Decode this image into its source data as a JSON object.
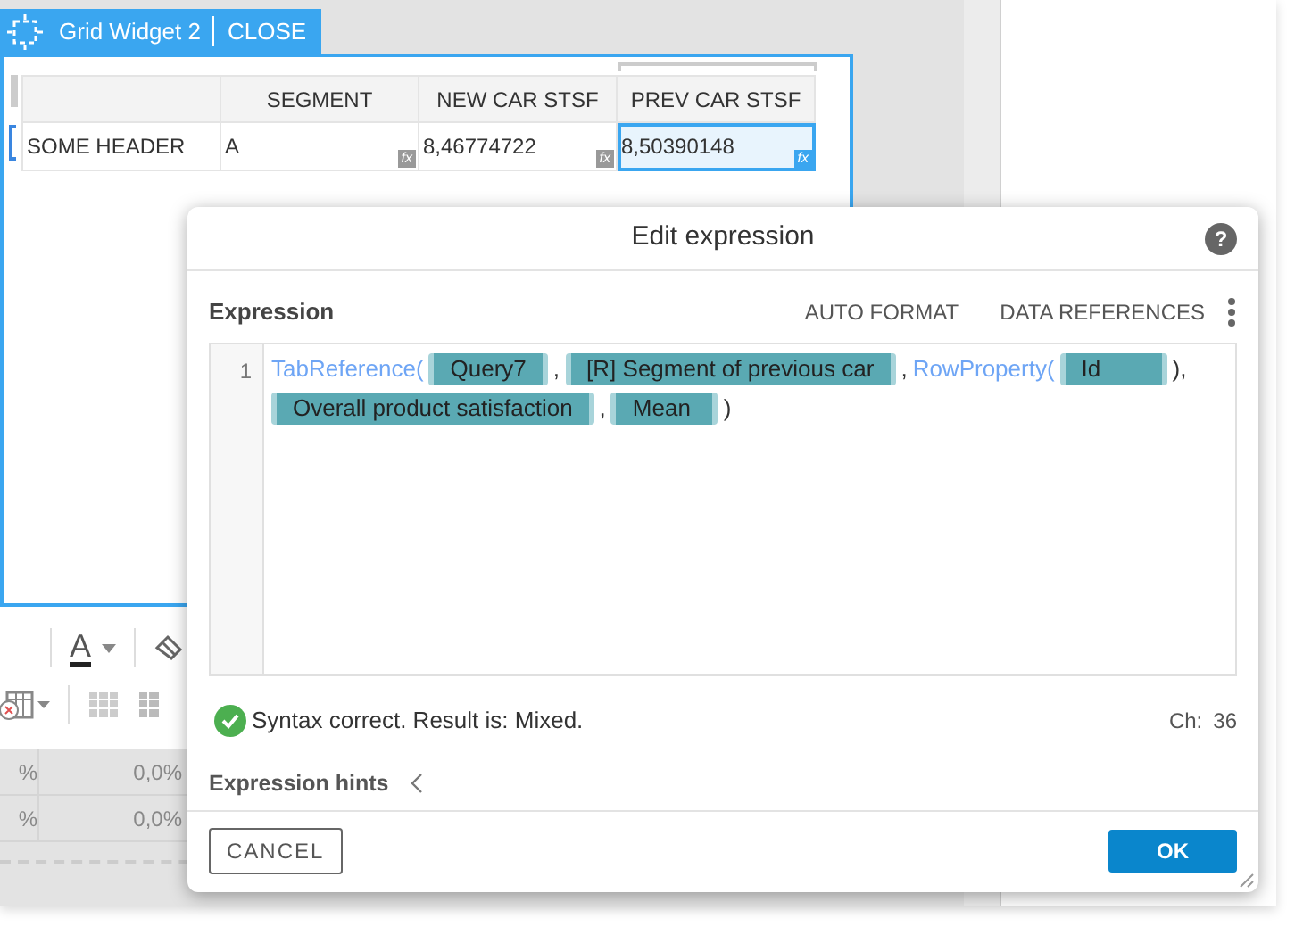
{
  "widget": {
    "title": "Grid Widget 2",
    "close": "CLOSE",
    "table": {
      "columns": [
        "SEGMENT",
        "NEW CAR STSF",
        "PREV CAR STSF"
      ],
      "rows": [
        {
          "header": "SOME HEADER",
          "cells": [
            {
              "text": "A",
              "marker": "fx",
              "selected": false
            },
            {
              "text": "8,46774722",
              "marker": "fx",
              "selected": false
            },
            {
              "text": "8,50390148",
              "marker": "fx",
              "selected": true
            }
          ]
        }
      ]
    }
  },
  "toolbar": {
    "font_color_glyph": "A"
  },
  "background_rows": [
    {
      "column_1": "%",
      "column_2": "0,0%"
    },
    {
      "column_1": "%",
      "column_2": "0,0%"
    }
  ],
  "dialog": {
    "title": "Edit expression",
    "help": "?",
    "label": "Expression",
    "actions": [
      "AUTO FORMAT",
      "DATA REFERENCES"
    ],
    "line_number": "1",
    "tokens": [
      {
        "kind": "func",
        "text": "TabReference("
      },
      {
        "kind": "chip",
        "text": "Query7"
      },
      {
        "kind": "plain",
        "text": ","
      },
      {
        "kind": "chip",
        "text": "[R] Segment of previous car"
      },
      {
        "kind": "plain",
        "text": ","
      },
      {
        "kind": "func",
        "text": "RowProperty("
      },
      {
        "kind": "chip",
        "text": "Id"
      },
      {
        "kind": "plain",
        "text": "),"
      },
      {
        "kind": "chip",
        "text": "Overall product satisfaction"
      },
      {
        "kind": "plain",
        "text": ","
      },
      {
        "kind": "chip",
        "text": "Mean"
      },
      {
        "kind": "plain",
        "text": ")"
      }
    ],
    "status": "Syntax correct. Result is: Mixed.",
    "valid": true,
    "char_label": "Ch:",
    "char_count": "36",
    "hints": "Expression hints",
    "hints_expanded": false,
    "cancel": "CANCEL",
    "ok": "OK"
  }
}
